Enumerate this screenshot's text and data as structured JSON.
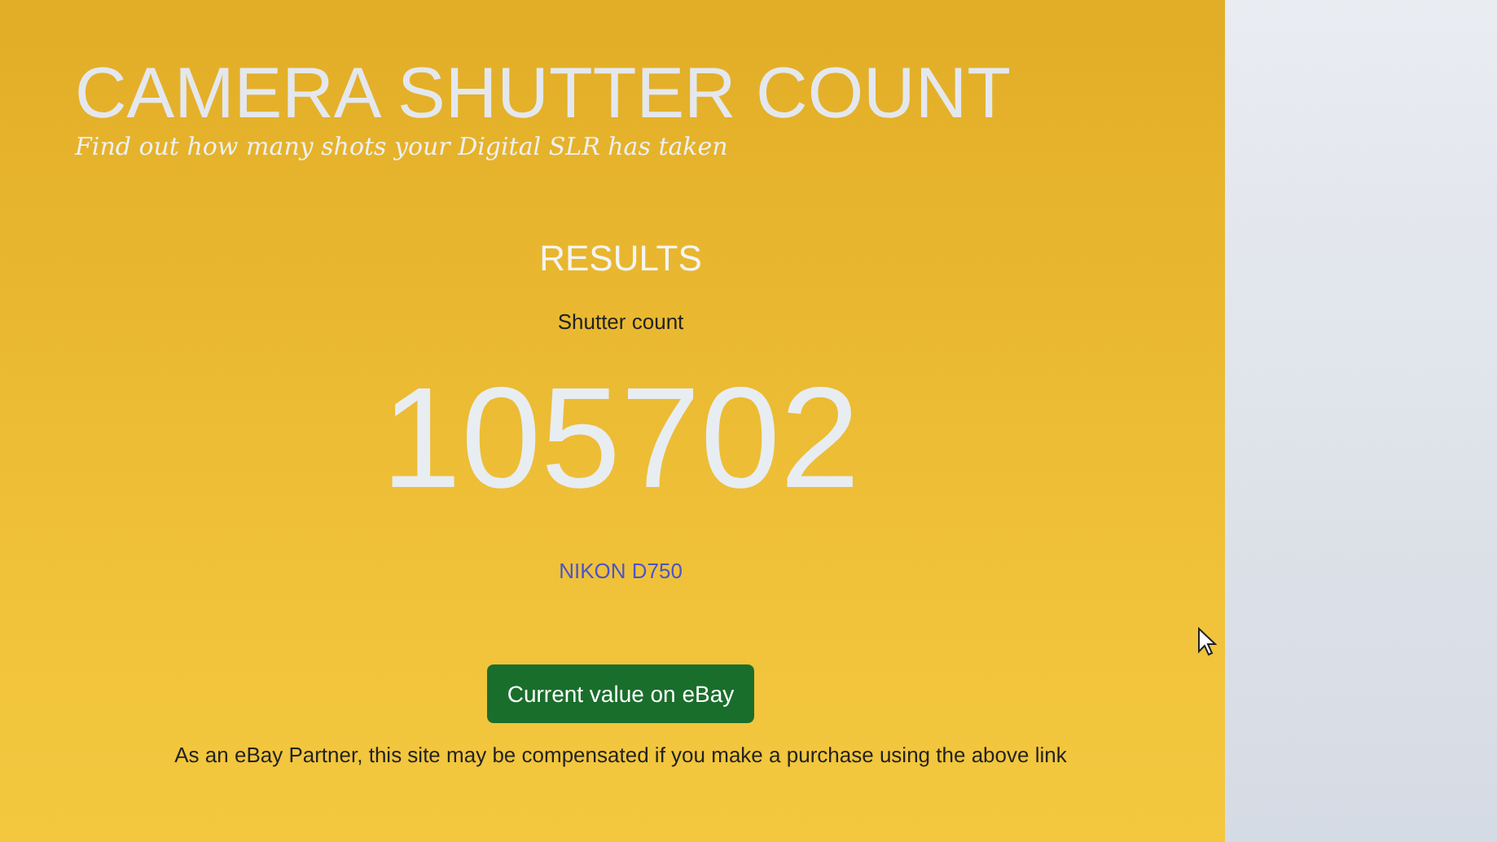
{
  "header": {
    "title": "CAMERA SHUTTER COUNT",
    "tagline": "Find out how many shots your Digital SLR has taken"
  },
  "results": {
    "heading": "RESULTS",
    "label": "Shutter count",
    "count": "105702",
    "camera": "NIKON D750"
  },
  "button": {
    "label": "Current value on eBay"
  },
  "disclaimer": "As an eBay Partner, this site may be compensated if you make a purchase using the above link"
}
